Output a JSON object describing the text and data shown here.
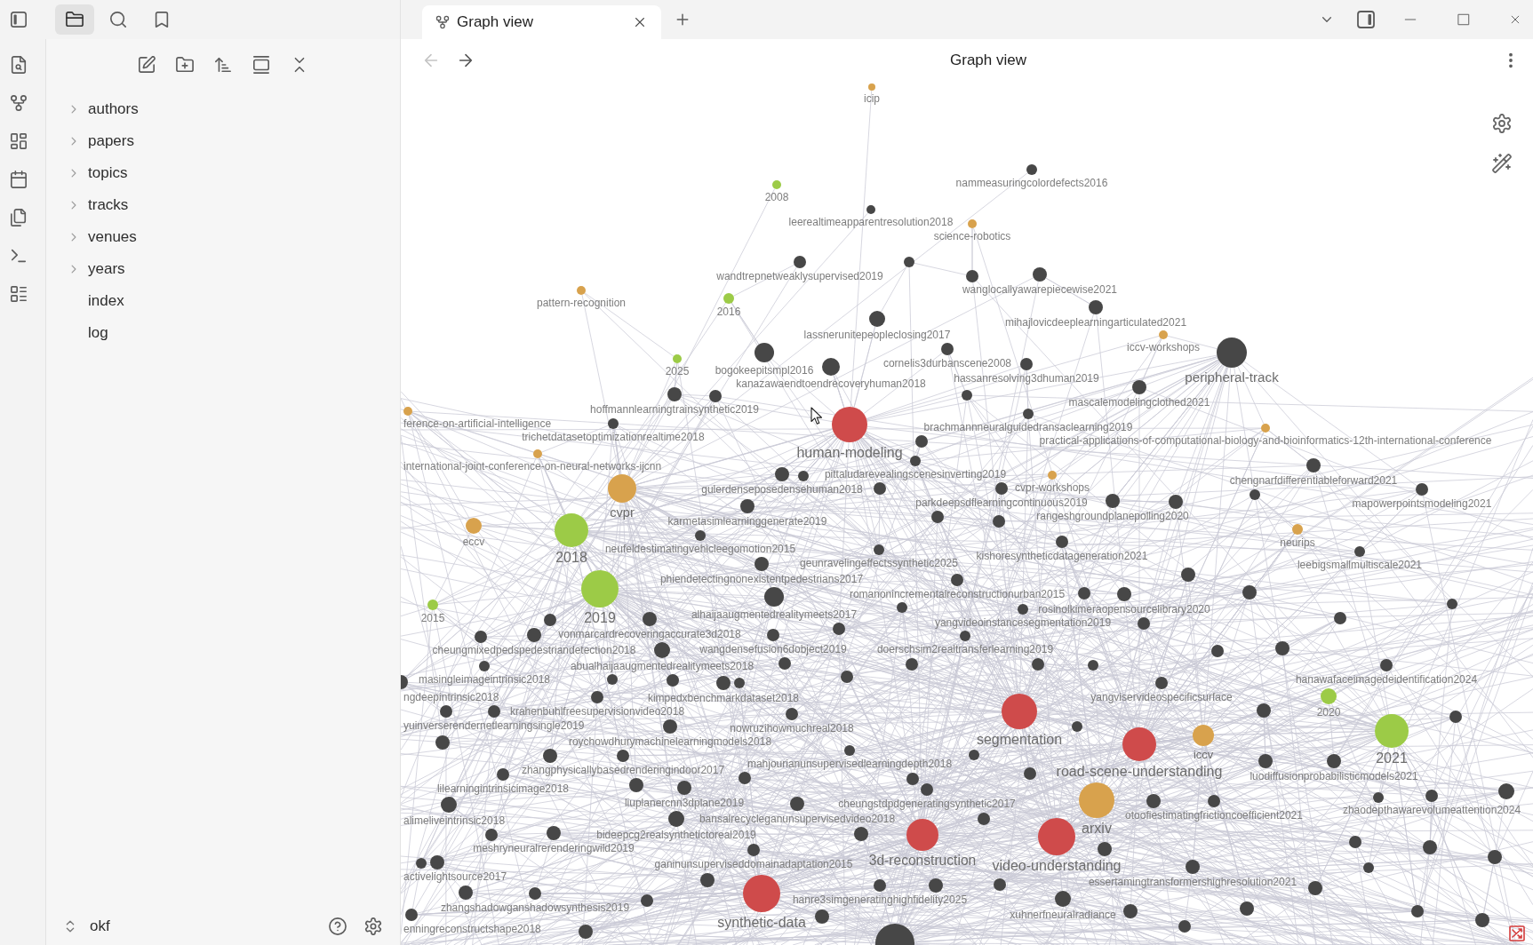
{
  "sidebar": {
    "tabs": [
      {
        "kind": "files",
        "selected": true
      },
      {
        "kind": "search",
        "selected": false
      },
      {
        "kind": "bookmarks",
        "selected": false
      }
    ],
    "tree": [
      {
        "name": "authors",
        "kind": "folder",
        "expanded": false
      },
      {
        "name": "papers",
        "kind": "folder",
        "expanded": false
      },
      {
        "name": "topics",
        "kind": "folder",
        "expanded": false
      },
      {
        "name": "tracks",
        "kind": "folder",
        "expanded": false
      },
      {
        "name": "venues",
        "kind": "folder",
        "expanded": false
      },
      {
        "name": "years",
        "kind": "folder",
        "expanded": false
      },
      {
        "name": "index",
        "kind": "file"
      },
      {
        "name": "log",
        "kind": "file"
      }
    ],
    "vault": {
      "name": "okf"
    }
  },
  "tabs": [
    {
      "title": "Graph view",
      "selected": true
    }
  ],
  "view": {
    "title": "Graph view",
    "back": {
      "disabled": true
    },
    "forward": {
      "disabled": false
    }
  },
  "graph": {
    "nodes": [
      {
        "label": "icip",
        "color": "#d8a24d"
      },
      {
        "label": "nammeasuringcolordefects2016",
        "color": "#474747"
      },
      {
        "label": "2008",
        "color": "#9ccb47"
      },
      {
        "label": "leerealtimeapparentresolution2018",
        "color": "#474747"
      },
      {
        "label": "science-robotics",
        "color": "#d8a24d"
      },
      {
        "label": "wandtrepnetweaklysupervised2019",
        "color": "#474747"
      },
      {
        "label": "wanglocallyawarepiecewise2021",
        "color": "#474747"
      },
      {
        "label": "pattern-recognition",
        "color": "#d8a24d"
      },
      {
        "label": "2016",
        "color": "#9ccb47"
      },
      {
        "label": "mihajlovicdeeplearningarticulated2021",
        "color": "#474747"
      },
      {
        "label": "lassnerunitepeopleclosing2017",
        "color": "#474747"
      },
      {
        "label": "iccv-workshops",
        "color": "#d8a24d"
      },
      {
        "label": "2025",
        "color": "#9ccb47"
      },
      {
        "label": "bogokeepitsmpl2016",
        "color": "#474747"
      },
      {
        "label": "cornelis3durbanscene2008",
        "color": "#474747"
      },
      {
        "label": "kanazawaendtoendrecoveryhuman2018",
        "color": "#474747"
      },
      {
        "label": "hassanresolving3dhuman2019",
        "color": "#474747"
      },
      {
        "label": "peripheral-track",
        "color": "#474747"
      },
      {
        "label": "hoffmannlearningtrainsynthetic2019",
        "color": "#474747"
      },
      {
        "label": "mascalemodelingclothed2021",
        "color": "#474747"
      },
      {
        "label": "ference-on-artificial-intelligence",
        "color": "#d8a24d"
      },
      {
        "label": "trichetdatasetoptimizationrealtime2018",
        "color": "#474747"
      },
      {
        "label": "brachmannneuralguidedransaclearning2019",
        "color": "#474747"
      },
      {
        "label": "international-joint-conference-on-neural-networks-ijcnn",
        "color": "#d8a24d"
      },
      {
        "label": "human-modeling",
        "color": "#cf4b4b"
      },
      {
        "label": "practical-applications-of-computational-biology-and-bioinformatics-12th-international-conference",
        "color": "#d8a24d"
      },
      {
        "label": "pittaludarevealingscenesinverting2019",
        "color": "#474747"
      },
      {
        "label": "gulerdenseposedensehuman2018",
        "color": "#474747"
      },
      {
        "label": "cvpr-workshops",
        "color": "#d8a24d"
      },
      {
        "label": "chengnarfdifferentiableforward2021",
        "color": "#474747"
      },
      {
        "label": "cvpr",
        "color": "#d8a24d"
      },
      {
        "label": "parkdeepsdflearningcontinuous2019",
        "color": "#474747"
      },
      {
        "label": "karmetasimlearninggenerate2019",
        "color": "#474747"
      },
      {
        "label": "rangeshgroundplanepolling2020",
        "color": "#474747"
      },
      {
        "label": "mapowerpointsmodeling2021",
        "color": "#474747"
      },
      {
        "label": "eccv",
        "color": "#d8a24d"
      },
      {
        "label": "2018",
        "color": "#9ccb47"
      },
      {
        "label": "neufeldestimatingvehicleegomotion2015",
        "color": "#474747"
      },
      {
        "label": "geunravelingeffectssynthetic2025",
        "color": "#474747"
      },
      {
        "label": "kishoresyntheticdatageneration2021",
        "color": "#474747"
      },
      {
        "label": "neurips",
        "color": "#d8a24d"
      },
      {
        "label": "leebigsmallmultiscale2021",
        "color": "#474747"
      },
      {
        "label": "phiendetectingnonexistentpedestrians2017",
        "color": "#474747"
      },
      {
        "label": "romanonincrementalreconstructionurban2015",
        "color": "#474747"
      },
      {
        "label": "2015",
        "color": "#9ccb47"
      },
      {
        "label": "2019",
        "color": "#9ccb47"
      },
      {
        "label": "alhaijaaugmentedrealitymeets2017",
        "color": "#474747"
      },
      {
        "label": "vonmarcardrecoveringaccurate3d2018",
        "color": "#474747"
      },
      {
        "label": "yangvideoinstancesegmentation2019",
        "color": "#474747"
      },
      {
        "label": "rosinolkimeraopensourcelibrary2020",
        "color": "#474747"
      },
      {
        "label": "cheungmixedpedspedestriandetection2018",
        "color": "#474747"
      },
      {
        "label": "wangdensefusion6dobject2019",
        "color": "#474747"
      },
      {
        "label": "doerschsim2realtransferlearning2019",
        "color": "#474747"
      },
      {
        "label": "masingleimageintrinsic2018",
        "color": "#474747"
      },
      {
        "label": "abualhaijaaugmentedrealitymeets2018",
        "color": "#474747"
      },
      {
        "label": "hanawafaceimagedeidentification2024",
        "color": "#474747"
      },
      {
        "label": "ngdeepintrinsic2018",
        "color": "#474747"
      },
      {
        "label": "krahenbuhlfreesupervisionvideo2018",
        "color": "#474747"
      },
      {
        "label": "kimpedxbenchmarkdataset2018",
        "color": "#474747"
      },
      {
        "label": "yangviservideospecificsurface",
        "color": "#474747"
      },
      {
        "label": "2020",
        "color": "#9ccb47"
      },
      {
        "label": "yuinverserendernetlearningsingle2019",
        "color": "#474747"
      },
      {
        "label": "roychowdhurymachinelearningmodels2018",
        "color": "#474747"
      },
      {
        "label": "nowruzihowmuchreal2018",
        "color": "#474747"
      },
      {
        "label": "segmentation",
        "color": "#cf4b4b"
      },
      {
        "label": "zhangphysicallybasedrenderingindoor2017",
        "color": "#474747"
      },
      {
        "label": "mahjourianunsupervisedlearningdepth2018",
        "color": "#474747"
      },
      {
        "label": "road-scene-understanding",
        "color": "#cf4b4b"
      },
      {
        "label": "iccv",
        "color": "#d8a24d"
      },
      {
        "label": "2021",
        "color": "#9ccb47"
      },
      {
        "label": "lilearningintrinsicimage2018",
        "color": "#474747"
      },
      {
        "label": "luodiffusionprobabilisticmodels2021",
        "color": "#474747"
      },
      {
        "label": "liuplanercnn3dplane2019",
        "color": "#474747"
      },
      {
        "label": "cheungstdpdgeneratingsynthetic2017",
        "color": "#474747"
      },
      {
        "label": "alimeliveintrinsic2018",
        "color": "#474747"
      },
      {
        "label": "bansalrecycleganunsupervisedvideo2018",
        "color": "#474747"
      },
      {
        "label": "bideepcg2realsynthetictoreal2019",
        "color": "#474747"
      },
      {
        "label": "arxiv",
        "color": "#d8a24d"
      },
      {
        "label": "otoofiestimatingfrictioncoefficient2021",
        "color": "#474747"
      },
      {
        "label": "zhaodepthawarevolumeattention2024",
        "color": "#474747"
      },
      {
        "label": "meshryneuralrerenderingwild2019",
        "color": "#474747"
      },
      {
        "label": "activelightsource2017",
        "color": "#474747"
      },
      {
        "label": "ganinunsuperviseddomainadaptation2015",
        "color": "#474747"
      },
      {
        "label": "3d-reconstruction",
        "color": "#cf4b4b"
      },
      {
        "label": "video-understanding",
        "color": "#cf4b4b"
      },
      {
        "label": "essertamingtransformershighresolution2021",
        "color": "#474747"
      },
      {
        "label": "zhangshadowganshadowsynthesis2019",
        "color": "#474747"
      },
      {
        "label": "hanre3simgeneratinghighfidelity2025",
        "color": "#474747"
      },
      {
        "label": "enningreconstructshape2018",
        "color": "#474747"
      },
      {
        "label": "synthetic-data",
        "color": "#cf4b4b"
      },
      {
        "label": "xuhnerfneuralradiance",
        "color": "#474747"
      },
      {
        "color": "#474747"
      },
      {
        "color": "#474747"
      },
      {
        "color": "#474747"
      },
      {
        "color": "#474747"
      },
      {
        "color": "#474747"
      },
      {
        "color": "#474747"
      },
      {
        "color": "#474747"
      },
      {
        "color": "#474747"
      },
      {
        "color": "#474747"
      },
      {
        "color": "#474747"
      },
      {
        "color": "#474747"
      },
      {
        "color": "#474747"
      },
      {
        "color": "#474747"
      },
      {
        "color": "#474747"
      },
      {
        "color": "#474747"
      },
      {
        "color": "#474747"
      },
      {
        "color": "#474747"
      },
      {
        "color": "#474747"
      },
      {
        "color": "#474747"
      },
      {
        "color": "#474747"
      },
      {
        "color": "#474747"
      },
      {
        "color": "#474747"
      },
      {
        "color": "#474747"
      },
      {
        "color": "#474747"
      },
      {
        "color": "#474747"
      },
      {
        "color": "#474747"
      },
      {
        "color": "#474747"
      },
      {
        "color": "#474747"
      },
      {
        "color": "#474747"
      },
      {
        "color": "#474747"
      },
      {
        "color": "#474747"
      },
      {
        "color": "#474747"
      },
      {
        "color": "#474747"
      },
      {
        "color": "#474747"
      },
      {
        "color": "#474747"
      },
      {
        "color": "#474747"
      },
      {
        "color": "#474747"
      },
      {
        "color": "#474747"
      },
      {
        "color": "#474747"
      },
      {
        "color": "#474747"
      },
      {
        "color": "#474747"
      },
      {
        "color": "#474747"
      },
      {
        "color": "#474747"
      },
      {
        "color": "#474747"
      },
      {
        "color": "#474747"
      },
      {
        "color": "#474747"
      },
      {
        "color": "#474747"
      },
      {
        "color": "#474747"
      },
      {
        "color": "#474747"
      },
      {
        "color": "#474747"
      },
      {
        "color": "#474747"
      },
      {
        "color": "#474747"
      },
      {
        "color": "#474747"
      },
      {
        "color": "#474747"
      },
      {
        "color": "#474747"
      },
      {
        "color": "#474747"
      },
      {
        "color": "#474747"
      },
      {
        "color": "#474747"
      },
      {
        "color": "#474747"
      },
      {
        "color": "#474747"
      },
      {
        "color": "#474747"
      },
      {
        "color": "#474747"
      },
      {
        "color": "#474747"
      },
      {
        "color": "#474747"
      },
      {
        "color": "#474747"
      },
      {
        "color": "#474747"
      },
      {
        "color": "#474747"
      },
      {
        "color": "#474747"
      },
      {
        "color": "#474747"
      }
    ]
  }
}
